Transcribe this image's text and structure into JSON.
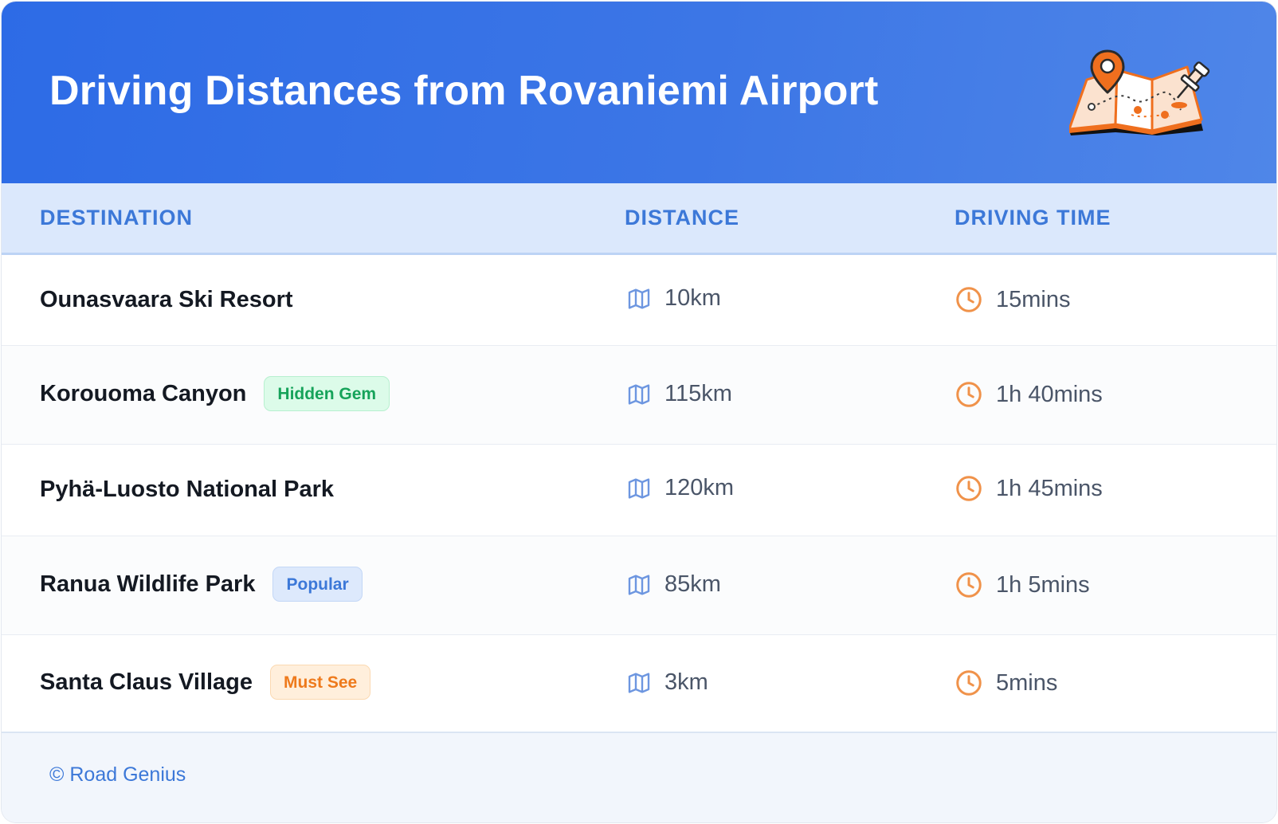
{
  "header": {
    "title": "Driving Distances from Rovaniemi Airport",
    "illustration_icon": "folded-map-with-pins-icon"
  },
  "table": {
    "columns": [
      "DESTINATION",
      "DISTANCE",
      "DRIVING TIME"
    ],
    "distance_icon": "map-icon",
    "time_icon": "clock-icon",
    "rows": [
      {
        "destination": "Ounasvaara Ski Resort",
        "badge": "",
        "badge_style": "",
        "distance": "10km",
        "time": "15mins"
      },
      {
        "destination": "Korouoma Canyon",
        "badge": "Hidden Gem",
        "badge_style": "green",
        "distance": "115km",
        "time": "1h 40mins"
      },
      {
        "destination": "Pyhä-Luosto National Park",
        "badge": "",
        "badge_style": "",
        "distance": "120km",
        "time": "1h 45mins"
      },
      {
        "destination": "Ranua Wildlife Park",
        "badge": "Popular",
        "badge_style": "blue",
        "distance": "85km",
        "time": "1h 5mins"
      },
      {
        "destination": "Santa Claus Village",
        "badge": "Must See",
        "badge_style": "orange",
        "distance": "3km",
        "time": "5mins"
      }
    ]
  },
  "footer": {
    "copyright": "© Road Genius"
  },
  "colors": {
    "header_gradient_start": "#2d6be6",
    "header_gradient_end": "#4f86e8",
    "accent_blue": "#3c78d8",
    "clock_orange": "#f0924a",
    "badge_green": "#16a35a",
    "badge_orange": "#ee7a1c"
  }
}
